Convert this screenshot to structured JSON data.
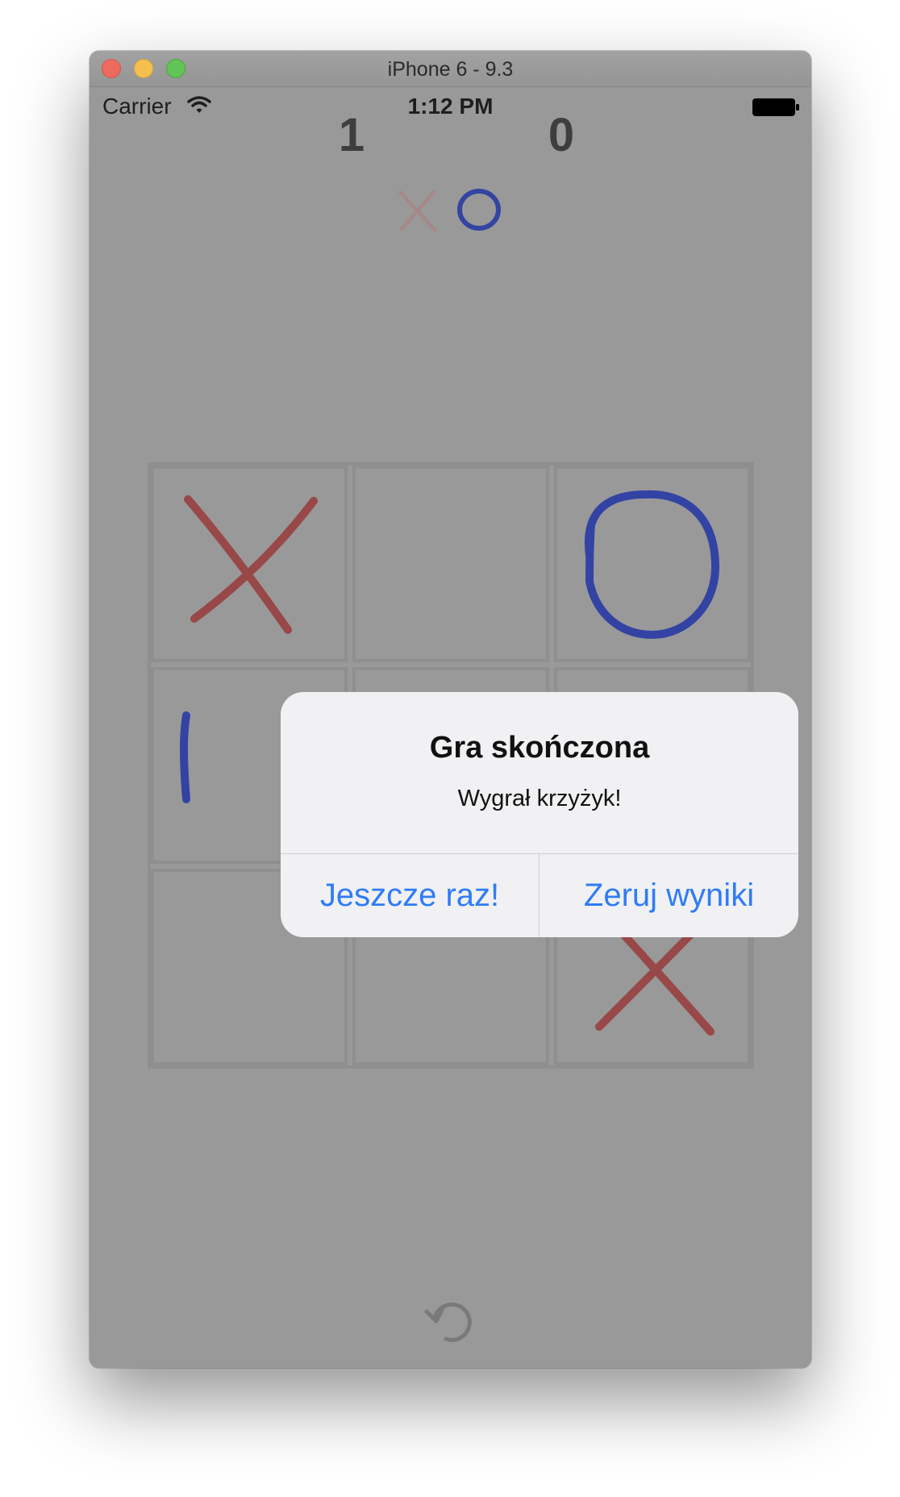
{
  "window": {
    "title": "iPhone 6 - 9.3"
  },
  "status_bar": {
    "carrier": "Carrier",
    "time": "1:12 PM",
    "wifi_icon": "wifi-icon",
    "battery_icon": "battery-full-icon"
  },
  "score": {
    "x_wins": "1",
    "o_wins": "0",
    "x_icon": "cross-icon",
    "o_icon": "circle-icon",
    "active_player": "O"
  },
  "board": {
    "cells": [
      "X",
      "",
      "O",
      "O",
      "",
      "",
      "",
      "",
      "X"
    ]
  },
  "toolbar": {
    "reset_icon": "undo-icon"
  },
  "alert": {
    "title": "Gra skończona",
    "message": "Wygrał krzyżyk!",
    "buttons": {
      "again": "Jeszcze raz!",
      "reset": "Zeruj wyniki"
    }
  },
  "colors": {
    "x_mark": "#984848",
    "o_mark": "#3343a4",
    "alert_button": "#2f7cf6",
    "dim_background": "#999999"
  }
}
